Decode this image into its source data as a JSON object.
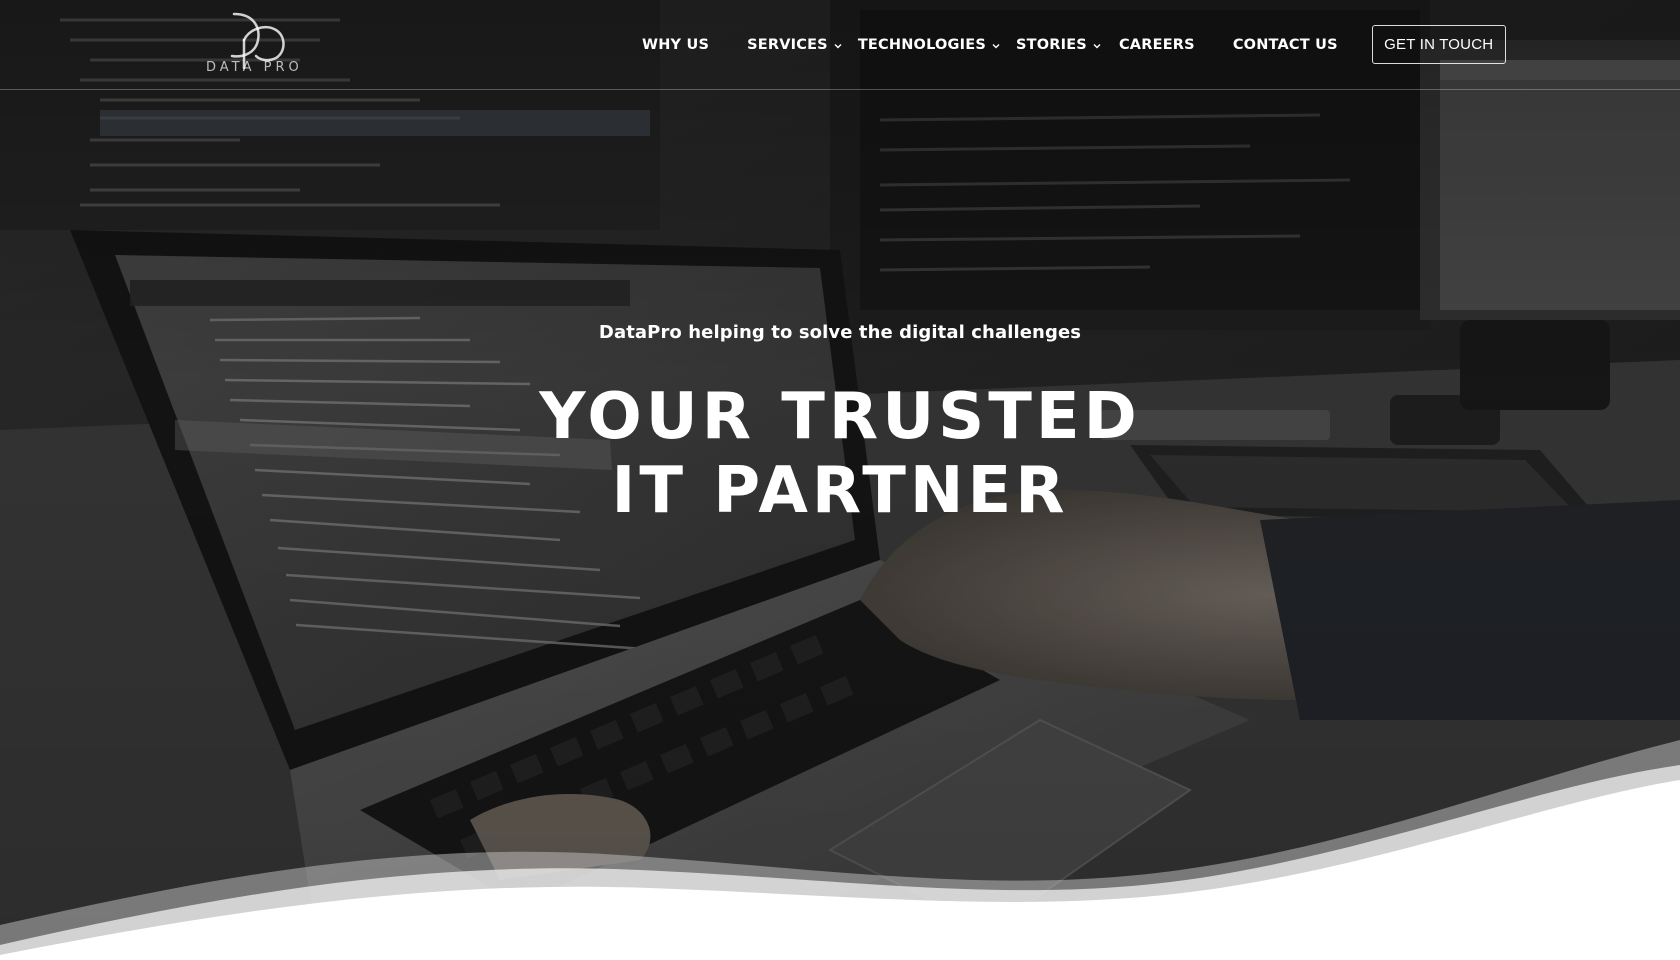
{
  "brand": {
    "logo_monogram": "DP",
    "logo_text": "DATA PRO"
  },
  "nav": {
    "items": [
      {
        "label": "WHY US"
      },
      {
        "label": "SERVICES"
      },
      {
        "label": "TECHNOLOGIES"
      },
      {
        "label": "STORIES"
      },
      {
        "label": "CAREERS"
      },
      {
        "label": "CONTACT US"
      }
    ],
    "cta_label": "GET IN TOUCH"
  },
  "hero": {
    "tagline": "DataPro helping to solve the digital challenges",
    "headline_line1": "YOUR TRUSTED",
    "headline_line2": "IT PARTNER"
  },
  "colors": {
    "overlay": "#2b2b2b",
    "text": "#ffffff",
    "wave": "#ffffff"
  },
  "icons": {
    "dropdown": "chevron-down-icon"
  }
}
